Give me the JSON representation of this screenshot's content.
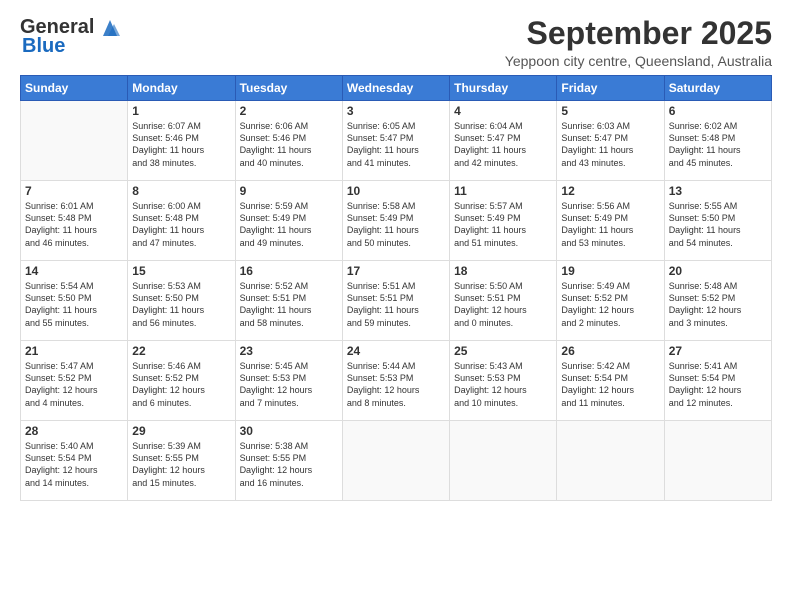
{
  "header": {
    "logo_general": "General",
    "logo_blue": "Blue",
    "title": "September 2025",
    "subtitle": "Yeppoon city centre, Queensland, Australia"
  },
  "columns": [
    "Sunday",
    "Monday",
    "Tuesday",
    "Wednesday",
    "Thursday",
    "Friday",
    "Saturday"
  ],
  "weeks": [
    [
      {
        "day": "",
        "info": ""
      },
      {
        "day": "1",
        "info": "Sunrise: 6:07 AM\nSunset: 5:46 PM\nDaylight: 11 hours\nand 38 minutes."
      },
      {
        "day": "2",
        "info": "Sunrise: 6:06 AM\nSunset: 5:46 PM\nDaylight: 11 hours\nand 40 minutes."
      },
      {
        "day": "3",
        "info": "Sunrise: 6:05 AM\nSunset: 5:47 PM\nDaylight: 11 hours\nand 41 minutes."
      },
      {
        "day": "4",
        "info": "Sunrise: 6:04 AM\nSunset: 5:47 PM\nDaylight: 11 hours\nand 42 minutes."
      },
      {
        "day": "5",
        "info": "Sunrise: 6:03 AM\nSunset: 5:47 PM\nDaylight: 11 hours\nand 43 minutes."
      },
      {
        "day": "6",
        "info": "Sunrise: 6:02 AM\nSunset: 5:48 PM\nDaylight: 11 hours\nand 45 minutes."
      }
    ],
    [
      {
        "day": "7",
        "info": "Sunrise: 6:01 AM\nSunset: 5:48 PM\nDaylight: 11 hours\nand 46 minutes."
      },
      {
        "day": "8",
        "info": "Sunrise: 6:00 AM\nSunset: 5:48 PM\nDaylight: 11 hours\nand 47 minutes."
      },
      {
        "day": "9",
        "info": "Sunrise: 5:59 AM\nSunset: 5:49 PM\nDaylight: 11 hours\nand 49 minutes."
      },
      {
        "day": "10",
        "info": "Sunrise: 5:58 AM\nSunset: 5:49 PM\nDaylight: 11 hours\nand 50 minutes."
      },
      {
        "day": "11",
        "info": "Sunrise: 5:57 AM\nSunset: 5:49 PM\nDaylight: 11 hours\nand 51 minutes."
      },
      {
        "day": "12",
        "info": "Sunrise: 5:56 AM\nSunset: 5:49 PM\nDaylight: 11 hours\nand 53 minutes."
      },
      {
        "day": "13",
        "info": "Sunrise: 5:55 AM\nSunset: 5:50 PM\nDaylight: 11 hours\nand 54 minutes."
      }
    ],
    [
      {
        "day": "14",
        "info": "Sunrise: 5:54 AM\nSunset: 5:50 PM\nDaylight: 11 hours\nand 55 minutes."
      },
      {
        "day": "15",
        "info": "Sunrise: 5:53 AM\nSunset: 5:50 PM\nDaylight: 11 hours\nand 56 minutes."
      },
      {
        "day": "16",
        "info": "Sunrise: 5:52 AM\nSunset: 5:51 PM\nDaylight: 11 hours\nand 58 minutes."
      },
      {
        "day": "17",
        "info": "Sunrise: 5:51 AM\nSunset: 5:51 PM\nDaylight: 11 hours\nand 59 minutes."
      },
      {
        "day": "18",
        "info": "Sunrise: 5:50 AM\nSunset: 5:51 PM\nDaylight: 12 hours\nand 0 minutes."
      },
      {
        "day": "19",
        "info": "Sunrise: 5:49 AM\nSunset: 5:52 PM\nDaylight: 12 hours\nand 2 minutes."
      },
      {
        "day": "20",
        "info": "Sunrise: 5:48 AM\nSunset: 5:52 PM\nDaylight: 12 hours\nand 3 minutes."
      }
    ],
    [
      {
        "day": "21",
        "info": "Sunrise: 5:47 AM\nSunset: 5:52 PM\nDaylight: 12 hours\nand 4 minutes."
      },
      {
        "day": "22",
        "info": "Sunrise: 5:46 AM\nSunset: 5:52 PM\nDaylight: 12 hours\nand 6 minutes."
      },
      {
        "day": "23",
        "info": "Sunrise: 5:45 AM\nSunset: 5:53 PM\nDaylight: 12 hours\nand 7 minutes."
      },
      {
        "day": "24",
        "info": "Sunrise: 5:44 AM\nSunset: 5:53 PM\nDaylight: 12 hours\nand 8 minutes."
      },
      {
        "day": "25",
        "info": "Sunrise: 5:43 AM\nSunset: 5:53 PM\nDaylight: 12 hours\nand 10 minutes."
      },
      {
        "day": "26",
        "info": "Sunrise: 5:42 AM\nSunset: 5:54 PM\nDaylight: 12 hours\nand 11 minutes."
      },
      {
        "day": "27",
        "info": "Sunrise: 5:41 AM\nSunset: 5:54 PM\nDaylight: 12 hours\nand 12 minutes."
      }
    ],
    [
      {
        "day": "28",
        "info": "Sunrise: 5:40 AM\nSunset: 5:54 PM\nDaylight: 12 hours\nand 14 minutes."
      },
      {
        "day": "29",
        "info": "Sunrise: 5:39 AM\nSunset: 5:55 PM\nDaylight: 12 hours\nand 15 minutes."
      },
      {
        "day": "30",
        "info": "Sunrise: 5:38 AM\nSunset: 5:55 PM\nDaylight: 12 hours\nand 16 minutes."
      },
      {
        "day": "",
        "info": ""
      },
      {
        "day": "",
        "info": ""
      },
      {
        "day": "",
        "info": ""
      },
      {
        "day": "",
        "info": ""
      }
    ]
  ]
}
